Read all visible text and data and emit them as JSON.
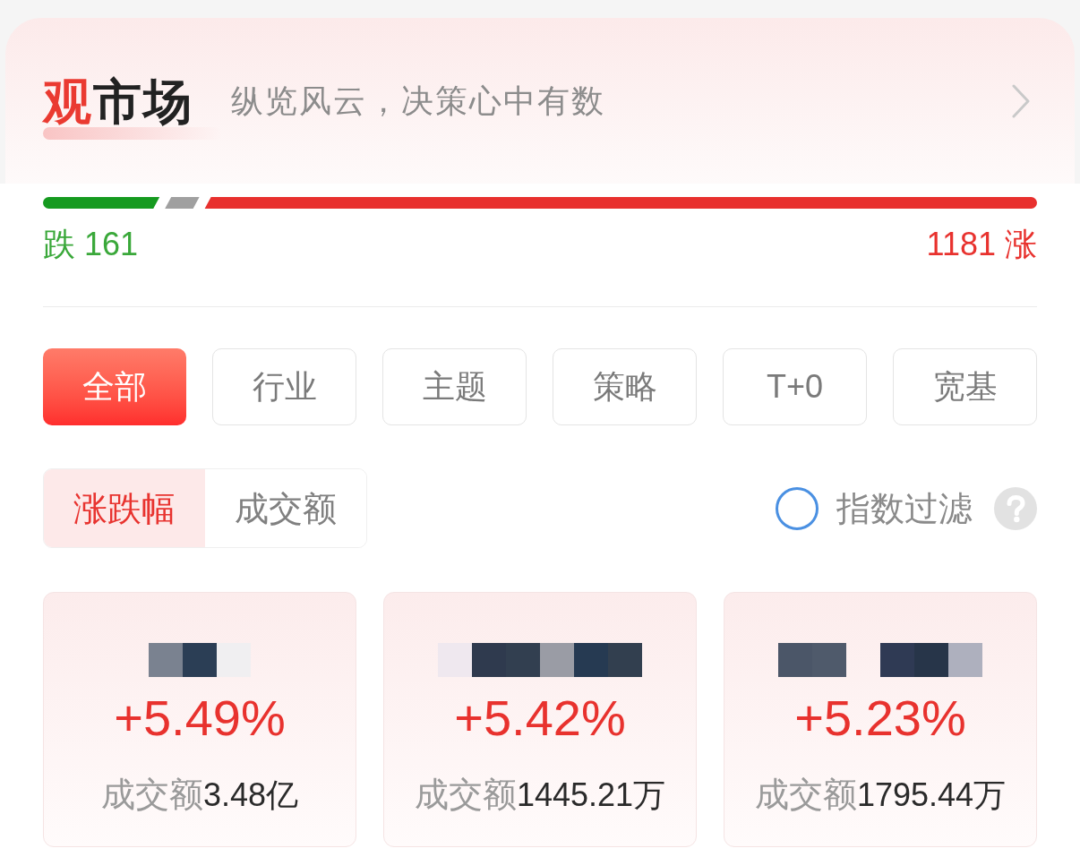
{
  "header": {
    "title_accent": "观",
    "title": "市场",
    "subtitle": "纵览风云，决策心中有数"
  },
  "breadth": {
    "segments": [
      {
        "kind": "down",
        "level": 0.12
      },
      {
        "kind": "flat"
      },
      {
        "kind": "up",
        "level": 0.84
      }
    ],
    "down_text": "跌 161",
    "up_text": "1181 涨"
  },
  "categories": [
    {
      "label": "全部",
      "selected": true
    },
    {
      "label": "行业",
      "selected": false
    },
    {
      "label": "主题",
      "selected": false
    },
    {
      "label": "策略",
      "selected": false
    },
    {
      "label": "T+0",
      "selected": false
    },
    {
      "label": "宽基",
      "selected": false
    }
  ],
  "sort_tabs": [
    {
      "label": "涨跌幅",
      "selected": true
    },
    {
      "label": "成交额",
      "selected": false
    }
  ],
  "index_filter": {
    "label": "指数过滤",
    "checked": false
  },
  "cards": [
    {
      "change": "+5.49%",
      "turnover_label": "成交额",
      "turnover": "3.48亿"
    },
    {
      "change": "+5.42%",
      "turnover_label": "成交额",
      "turnover": "1445.21万"
    },
    {
      "change": "+5.23%",
      "turnover_label": "成交额",
      "turnover": "1795.44万"
    }
  ]
}
